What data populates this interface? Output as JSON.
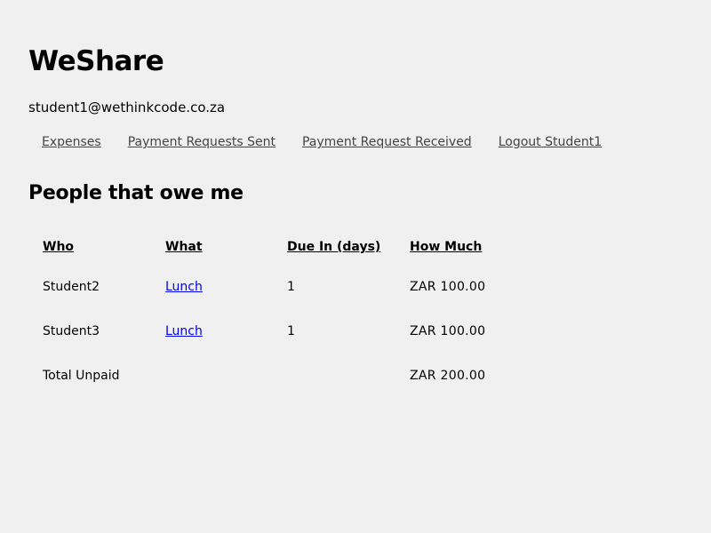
{
  "app": {
    "title": "WeShare",
    "user_email": "student1@wethinkcode.co.za"
  },
  "nav": {
    "items": [
      {
        "label": "Expenses"
      },
      {
        "label": "Payment Requests Sent"
      },
      {
        "label": "Payment Request Received"
      },
      {
        "label": "Logout Student1"
      }
    ]
  },
  "section": {
    "title": "People that owe me"
  },
  "table": {
    "headers": {
      "who": "Who",
      "what": "What",
      "due": "Due In (days)",
      "amount": "How Much"
    },
    "rows": [
      {
        "who": "Student2",
        "what": "Lunch",
        "due": "1",
        "amount": "ZAR 100.00"
      },
      {
        "who": "Student3",
        "what": "Lunch",
        "due": "1",
        "amount": "ZAR 100.00"
      }
    ],
    "total": {
      "label": "Total Unpaid",
      "amount": "ZAR 200.00"
    }
  },
  "colors": {
    "background": "#f0f0f0",
    "nav_link": "#444444",
    "table_link": "#0000ee"
  }
}
